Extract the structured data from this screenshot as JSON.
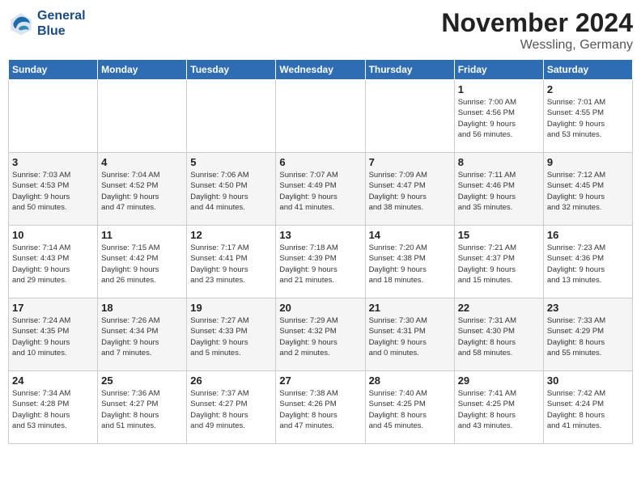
{
  "logo": {
    "line1": "General",
    "line2": "Blue"
  },
  "title": "November 2024",
  "location": "Wessling, Germany",
  "days_of_week": [
    "Sunday",
    "Monday",
    "Tuesday",
    "Wednesday",
    "Thursday",
    "Friday",
    "Saturday"
  ],
  "weeks": [
    [
      {
        "day": "",
        "info": ""
      },
      {
        "day": "",
        "info": ""
      },
      {
        "day": "",
        "info": ""
      },
      {
        "day": "",
        "info": ""
      },
      {
        "day": "",
        "info": ""
      },
      {
        "day": "1",
        "info": "Sunrise: 7:00 AM\nSunset: 4:56 PM\nDaylight: 9 hours\nand 56 minutes."
      },
      {
        "day": "2",
        "info": "Sunrise: 7:01 AM\nSunset: 4:55 PM\nDaylight: 9 hours\nand 53 minutes."
      }
    ],
    [
      {
        "day": "3",
        "info": "Sunrise: 7:03 AM\nSunset: 4:53 PM\nDaylight: 9 hours\nand 50 minutes."
      },
      {
        "day": "4",
        "info": "Sunrise: 7:04 AM\nSunset: 4:52 PM\nDaylight: 9 hours\nand 47 minutes."
      },
      {
        "day": "5",
        "info": "Sunrise: 7:06 AM\nSunset: 4:50 PM\nDaylight: 9 hours\nand 44 minutes."
      },
      {
        "day": "6",
        "info": "Sunrise: 7:07 AM\nSunset: 4:49 PM\nDaylight: 9 hours\nand 41 minutes."
      },
      {
        "day": "7",
        "info": "Sunrise: 7:09 AM\nSunset: 4:47 PM\nDaylight: 9 hours\nand 38 minutes."
      },
      {
        "day": "8",
        "info": "Sunrise: 7:11 AM\nSunset: 4:46 PM\nDaylight: 9 hours\nand 35 minutes."
      },
      {
        "day": "9",
        "info": "Sunrise: 7:12 AM\nSunset: 4:45 PM\nDaylight: 9 hours\nand 32 minutes."
      }
    ],
    [
      {
        "day": "10",
        "info": "Sunrise: 7:14 AM\nSunset: 4:43 PM\nDaylight: 9 hours\nand 29 minutes."
      },
      {
        "day": "11",
        "info": "Sunrise: 7:15 AM\nSunset: 4:42 PM\nDaylight: 9 hours\nand 26 minutes."
      },
      {
        "day": "12",
        "info": "Sunrise: 7:17 AM\nSunset: 4:41 PM\nDaylight: 9 hours\nand 23 minutes."
      },
      {
        "day": "13",
        "info": "Sunrise: 7:18 AM\nSunset: 4:39 PM\nDaylight: 9 hours\nand 21 minutes."
      },
      {
        "day": "14",
        "info": "Sunrise: 7:20 AM\nSunset: 4:38 PM\nDaylight: 9 hours\nand 18 minutes."
      },
      {
        "day": "15",
        "info": "Sunrise: 7:21 AM\nSunset: 4:37 PM\nDaylight: 9 hours\nand 15 minutes."
      },
      {
        "day": "16",
        "info": "Sunrise: 7:23 AM\nSunset: 4:36 PM\nDaylight: 9 hours\nand 13 minutes."
      }
    ],
    [
      {
        "day": "17",
        "info": "Sunrise: 7:24 AM\nSunset: 4:35 PM\nDaylight: 9 hours\nand 10 minutes."
      },
      {
        "day": "18",
        "info": "Sunrise: 7:26 AM\nSunset: 4:34 PM\nDaylight: 9 hours\nand 7 minutes."
      },
      {
        "day": "19",
        "info": "Sunrise: 7:27 AM\nSunset: 4:33 PM\nDaylight: 9 hours\nand 5 minutes."
      },
      {
        "day": "20",
        "info": "Sunrise: 7:29 AM\nSunset: 4:32 PM\nDaylight: 9 hours\nand 2 minutes."
      },
      {
        "day": "21",
        "info": "Sunrise: 7:30 AM\nSunset: 4:31 PM\nDaylight: 9 hours\nand 0 minutes."
      },
      {
        "day": "22",
        "info": "Sunrise: 7:31 AM\nSunset: 4:30 PM\nDaylight: 8 hours\nand 58 minutes."
      },
      {
        "day": "23",
        "info": "Sunrise: 7:33 AM\nSunset: 4:29 PM\nDaylight: 8 hours\nand 55 minutes."
      }
    ],
    [
      {
        "day": "24",
        "info": "Sunrise: 7:34 AM\nSunset: 4:28 PM\nDaylight: 8 hours\nand 53 minutes."
      },
      {
        "day": "25",
        "info": "Sunrise: 7:36 AM\nSunset: 4:27 PM\nDaylight: 8 hours\nand 51 minutes."
      },
      {
        "day": "26",
        "info": "Sunrise: 7:37 AM\nSunset: 4:27 PM\nDaylight: 8 hours\nand 49 minutes."
      },
      {
        "day": "27",
        "info": "Sunrise: 7:38 AM\nSunset: 4:26 PM\nDaylight: 8 hours\nand 47 minutes."
      },
      {
        "day": "28",
        "info": "Sunrise: 7:40 AM\nSunset: 4:25 PM\nDaylight: 8 hours\nand 45 minutes."
      },
      {
        "day": "29",
        "info": "Sunrise: 7:41 AM\nSunset: 4:25 PM\nDaylight: 8 hours\nand 43 minutes."
      },
      {
        "day": "30",
        "info": "Sunrise: 7:42 AM\nSunset: 4:24 PM\nDaylight: 8 hours\nand 41 minutes."
      }
    ]
  ]
}
